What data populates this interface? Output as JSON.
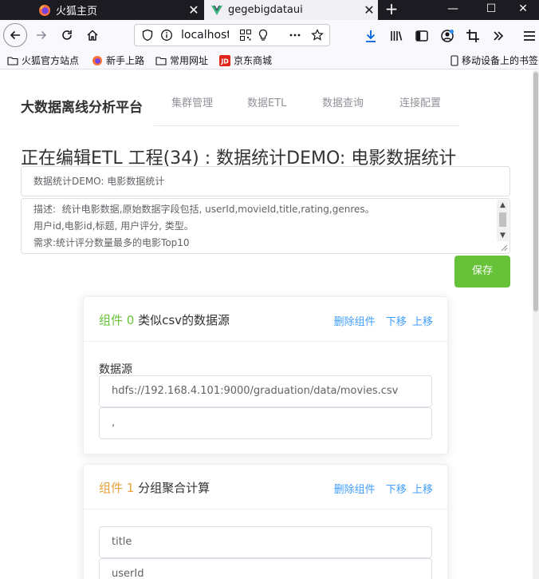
{
  "browser": {
    "tabs": [
      {
        "title": "火狐主页",
        "active": false
      },
      {
        "title": "gegebigdataui",
        "active": true
      }
    ],
    "url": "localhost",
    "bookmarks": [
      {
        "label": "火狐官方站点",
        "icon": "folder-icon"
      },
      {
        "label": "新手上路",
        "icon": "firefox-icon"
      },
      {
        "label": "常用网址",
        "icon": "folder-icon"
      },
      {
        "label": "京东商城",
        "icon": "jd-icon"
      }
    ],
    "mobile_bookmarks": "移动设备上的书签"
  },
  "app": {
    "brand": "大数据离线分析平台",
    "nav": [
      "集群管理",
      "数据ETL",
      "数据查询",
      "连接配置"
    ],
    "page_title": "正在编辑ETL 工程(34) : 数据统计DEMO: 电影数据统计",
    "project_name": "数据统计DEMO: 电影数据统计",
    "description": "描述:  统计电影数据,原始数据字段包括, userId,movieId,title,rating,genres。\n用户id,电影id,标题, 用户评分, 类型。\n需求:统计评分数量最多的电影Top10",
    "save_label": "保存",
    "accent_color": "#67c23a",
    "link_color": "#409eff"
  },
  "components": [
    {
      "index_label": "组件 0",
      "type_label": "类似csv的数据源",
      "delete_label": "删除组件",
      "move_down_label": "下移",
      "move_up_label": "上移",
      "field_label": "数据源",
      "fields": [
        "hdfs://192.168.4.101:9000/graduation/data/movies.csv",
        ","
      ]
    },
    {
      "index_label": "组件 1",
      "type_label": "分组聚合计算",
      "delete_label": "删除组件",
      "move_down_label": "下移",
      "move_up_label": "上移",
      "fields": [
        "title",
        "userId"
      ]
    }
  ]
}
